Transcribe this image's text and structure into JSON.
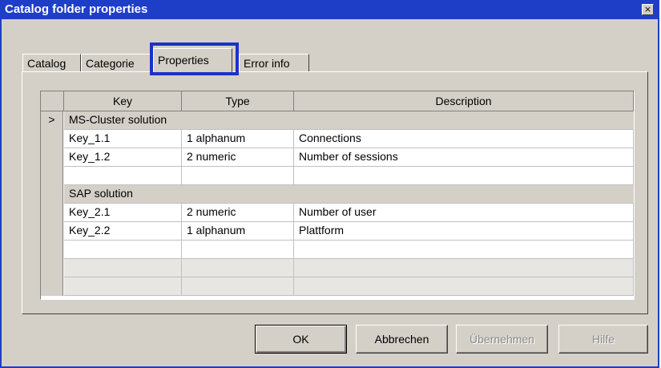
{
  "window": {
    "title": "Catalog folder properties",
    "close_label": "×"
  },
  "tabs": [
    {
      "label": "Catalog"
    },
    {
      "label": "Categorie"
    },
    {
      "label": "Properties"
    },
    {
      "label": "Error info"
    }
  ],
  "grid": {
    "columns": [
      "Key",
      "Type",
      "Description"
    ],
    "row_marker": ">",
    "groups": [
      {
        "name": "MS-Cluster solution",
        "rows": [
          {
            "key": "Key_1.1",
            "type": "1 alphanum",
            "description": "Connections"
          },
          {
            "key": "Key_1.2",
            "type": "2 numeric",
            "description": "Number of sessions"
          },
          {
            "key": "",
            "type": "",
            "description": ""
          }
        ]
      },
      {
        "name": "SAP solution",
        "rows": [
          {
            "key": "Key_2.1",
            "type": "2 numeric",
            "description": "Number of user"
          },
          {
            "key": "Key_2.2",
            "type": "1 alphanum",
            "description": "Plattform"
          },
          {
            "key": "",
            "type": "",
            "description": ""
          }
        ]
      }
    ]
  },
  "buttons": {
    "ok": "OK",
    "cancel": "Abbrechen",
    "apply": "Übernehmen",
    "help": "Hilfe"
  }
}
